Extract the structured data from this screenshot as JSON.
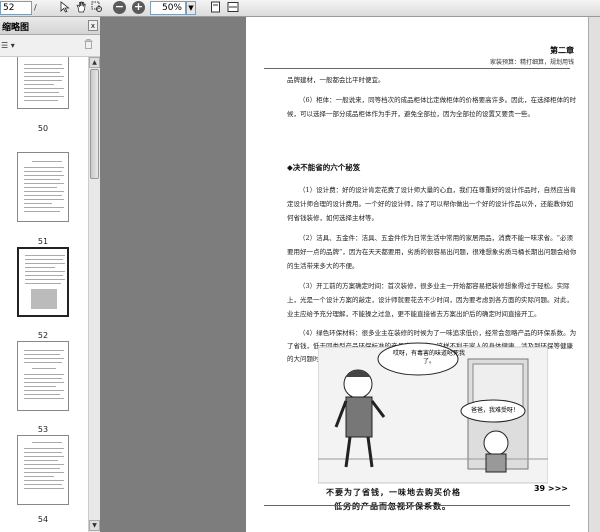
{
  "toolbar": {
    "page_input": "52",
    "page_count": "/ 230",
    "zoom_value": "50%",
    "zoom_out_label": "−",
    "zoom_in_label": "+",
    "hand_icon": "hand-icon",
    "select_icon": "select-icon"
  },
  "panel": {
    "title": "缩略图",
    "options_label": "☰ ▾",
    "close_label": "x",
    "thumbnails": [
      {
        "label": "50"
      },
      {
        "label": "51"
      },
      {
        "label": "52",
        "selected": true
      },
      {
        "label": "53"
      },
      {
        "label": "54"
      }
    ]
  },
  "page": {
    "chapter": "第二章",
    "chapter_sub": "家装预算：精打细算，规划用钱",
    "para1": "品牌建材，一般都会比平时便宜。",
    "para2": "（6）柜体：一般说来，同等档次的成品柜体比定做柜体的价格要高许多。因此，在选择柜体的时候，可以选择一部分成品柜体作为手开，避免全部拉，因为全部拉的设置又要贵一些。",
    "heading": "◆决不能省的六个秘笈",
    "para3": "（1）设计费：好的设计肯定花费了设计师大量的心血，我们在尊重好的设计作品时，自然应当肯定设计师合理的设计费用。一个好的设计师，除了可以帮你做出一个好的设计作品以外，还能教你如何省钱装修，如何选择主材等。",
    "para4": "（2）洁具、五金件：洁具、五金件作为日常生活中常用的家居用品，消费不能一味求省。“必须要用好一点的品牌”，因为在天天都要用，劣质的很容易出问题，很难想象劣质马桶长期出问题会给你的生活带来多大的不便。",
    "para5": "（3）开工前的方案确定时间：首次装修，很多业主一开始都容易把装修想象得过于轻松。实际上，光是一个设计方案的敲定，设计师就要花去不少时间，因为要考虑到各方面的实际问题。对此，业主应给予充分理解，不能操之过急，更不能直接省去方案出炉后的确定时间直接开工。",
    "para6": "（4）绿色环保材料：很多业主在装修的时候为了一味追求低价，经常会忽略产品的环保系数。为了省钱，低于同类型产品环保标准的产品也买回家，这样不利于家人的身体健康，涉及到环保等健康的大问题时，钱是不能省的。",
    "bubble1": "哎呀，有毒害的味道呛死我了。",
    "bubble2": "爸爸，我难受呀！",
    "caption_line1": "不要为了省钱，一味地去购买价格",
    "caption_line2": "低劣的产品而忽视环保系数。",
    "page_number": "39 >>>"
  }
}
